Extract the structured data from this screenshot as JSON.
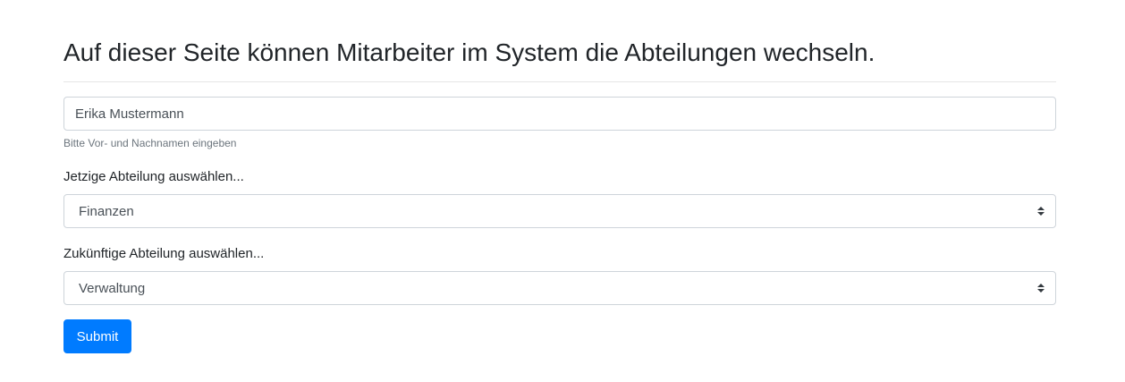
{
  "page": {
    "title": "Auf dieser Seite können Mitarbeiter im System die Abteilungen wechseln."
  },
  "form": {
    "name_field": {
      "value": "Erika Mustermann",
      "help_text": "Bitte Vor- und Nachnamen eingeben"
    },
    "current_department": {
      "label": "Jetzige Abteilung auswählen...",
      "selected": "Finanzen"
    },
    "future_department": {
      "label": "Zukünftige Abteilung auswählen...",
      "selected": "Verwaltung"
    },
    "submit_label": "Submit"
  },
  "colors": {
    "primary": "#007bff",
    "border": "#ced4da",
    "muted_text": "#6c757d"
  }
}
